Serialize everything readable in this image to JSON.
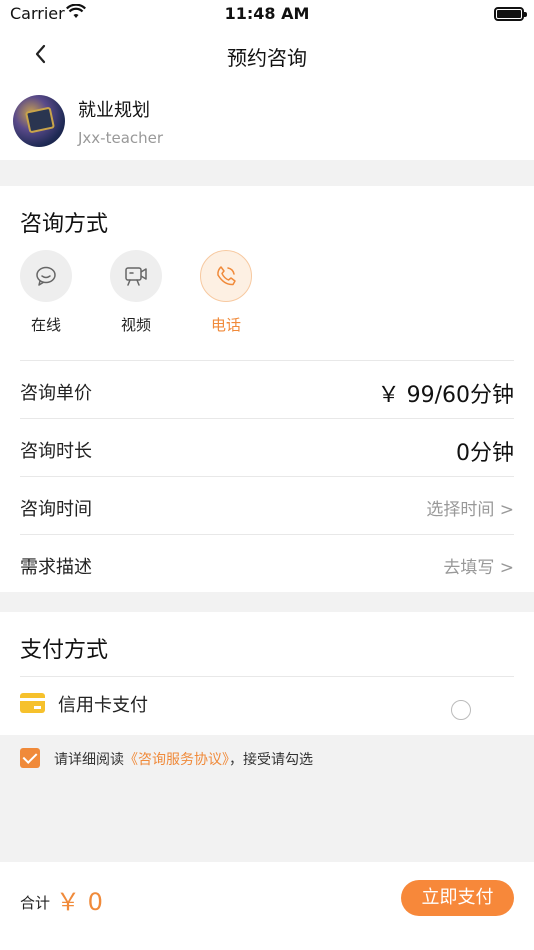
{
  "status_bar": {
    "carrier": "Carrier",
    "time": "11:48 AM"
  },
  "nav": {
    "title": "预约咨询",
    "back_icon": "chevron-left-icon"
  },
  "profile": {
    "name": "就业规划",
    "subtitle": "Jxx-teacher"
  },
  "consult": {
    "section_title": "咨询方式",
    "methods": [
      {
        "label": "在线",
        "icon": "chat-bubble-icon",
        "selected": false
      },
      {
        "label": "视频",
        "icon": "video-camera-icon",
        "selected": false
      },
      {
        "label": "电话",
        "icon": "phone-icon",
        "selected": true
      }
    ],
    "rows": [
      {
        "key": "咨询单价",
        "value": "￥ 99/60分钟"
      },
      {
        "key": "咨询时长",
        "value": "0分钟"
      },
      {
        "key": "咨询时间",
        "value": "选择时间 >"
      },
      {
        "key": "需求描述",
        "value": "去填写 >"
      }
    ]
  },
  "payment": {
    "section_title": "支付方式",
    "options": [
      {
        "label": "信用卡支付",
        "icon": "credit-card-icon",
        "selected": false
      }
    ]
  },
  "agreement": {
    "prefix": "请详细阅读",
    "link": "《咨询服务协议》",
    "suffix": "，接受请勾选",
    "checked": true
  },
  "footer": {
    "total_label": "合计",
    "total_value": "￥ 0",
    "pay_label": "立即支付"
  },
  "colors": {
    "accent": "#f08a3a",
    "background": "#f2f2f2",
    "card": "#ffffff"
  }
}
